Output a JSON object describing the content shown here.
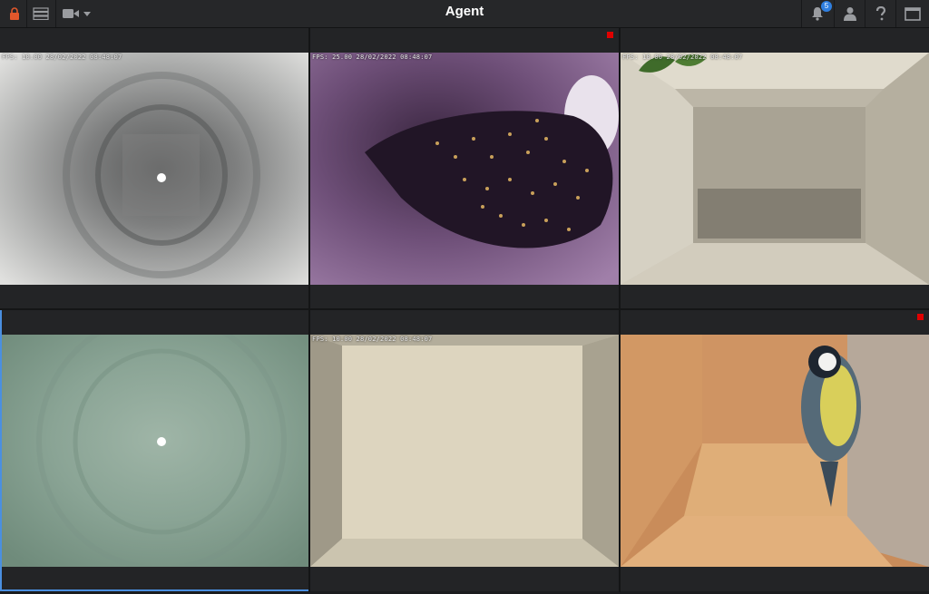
{
  "header": {
    "title": "Agent",
    "notification_count": "5",
    "icons": {
      "lock": "lock-icon",
      "server": "server-icon",
      "camera": "video-camera-icon",
      "dropdown": "chevron-down-icon",
      "notifications": "bell-icon",
      "user": "user-icon",
      "help": "help-icon",
      "window": "window-icon"
    }
  },
  "colors": {
    "accent": "#4a8fe0",
    "record": "#e00000",
    "badge": "#2f7fe0"
  },
  "cameras": [
    {
      "overlay": "FPS: 10.00 28/02/2022 08:48:07",
      "recording": false
    },
    {
      "overlay": "FPS: 25.00 28/02/2022 08:48:07",
      "recording": true
    },
    {
      "overlay": "FPS: 10.00 28/02/2022 08:48:07",
      "recording": false
    },
    {
      "overlay": "",
      "recording": false
    },
    {
      "overlay": "FPS: 10.00 28/02/2022 08:48:07",
      "recording": false
    },
    {
      "overlay": "",
      "recording": true
    }
  ]
}
